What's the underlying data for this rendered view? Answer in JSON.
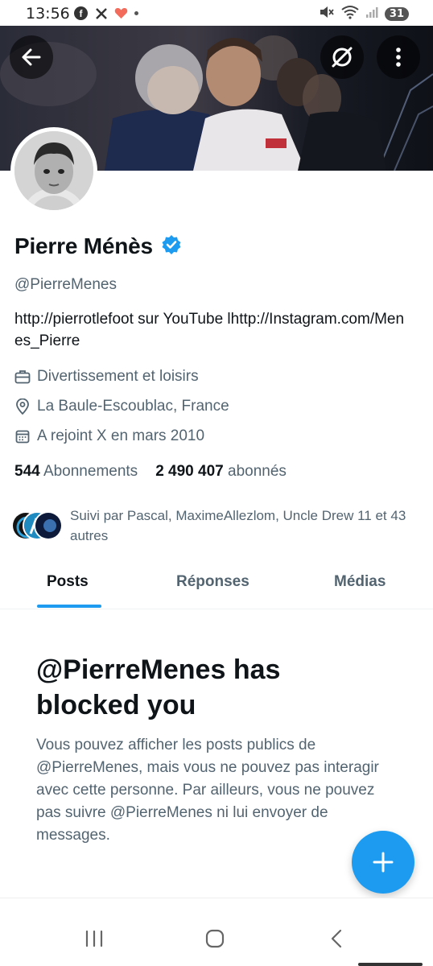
{
  "status_bar": {
    "time": "13:56",
    "app_icons": [
      "facebook-icon",
      "x-icon",
      "heart-icon"
    ],
    "battery": "31"
  },
  "header": {
    "back_icon": "arrow-left-icon",
    "grok_icon": "grok-icon",
    "more_icon": "more-vertical-icon"
  },
  "profile": {
    "name": "Pierre Ménès",
    "verified": true,
    "handle": "@PierreMenes",
    "bio": "http://pierrotlefoot sur YouTube lhttp://Instagram.com/Menes_Pierre",
    "category": "Divertissement et loisirs",
    "location": "La Baule-Escoublac, France",
    "joined": "A rejoint X en mars 2010",
    "following_count": "544",
    "following_label": "Abonnements",
    "followers_count": "2 490 407",
    "followers_label": "abonnés",
    "followed_by": "Suivi par Pascal, MaximeAllezlom, Uncle Drew 11 et 43 autres"
  },
  "tabs": [
    {
      "label": "Posts",
      "active": true
    },
    {
      "label": "Réponses",
      "active": false
    },
    {
      "label": "Médias",
      "active": false
    }
  ],
  "blocked": {
    "title": "@PierreMenes has blocked you",
    "body": "Vous pouvez afficher les posts publics de @PierreMenes, mais vous ne pouvez pas interagir avec cette personne. Par ailleurs, vous ne pouvez pas suivre @PierreMenes ni lui envoyer de messages."
  },
  "fab": {
    "icon": "plus-icon"
  },
  "colors": {
    "accent": "#1d9bf0",
    "text_primary": "#0f1419",
    "text_secondary": "#536471"
  }
}
